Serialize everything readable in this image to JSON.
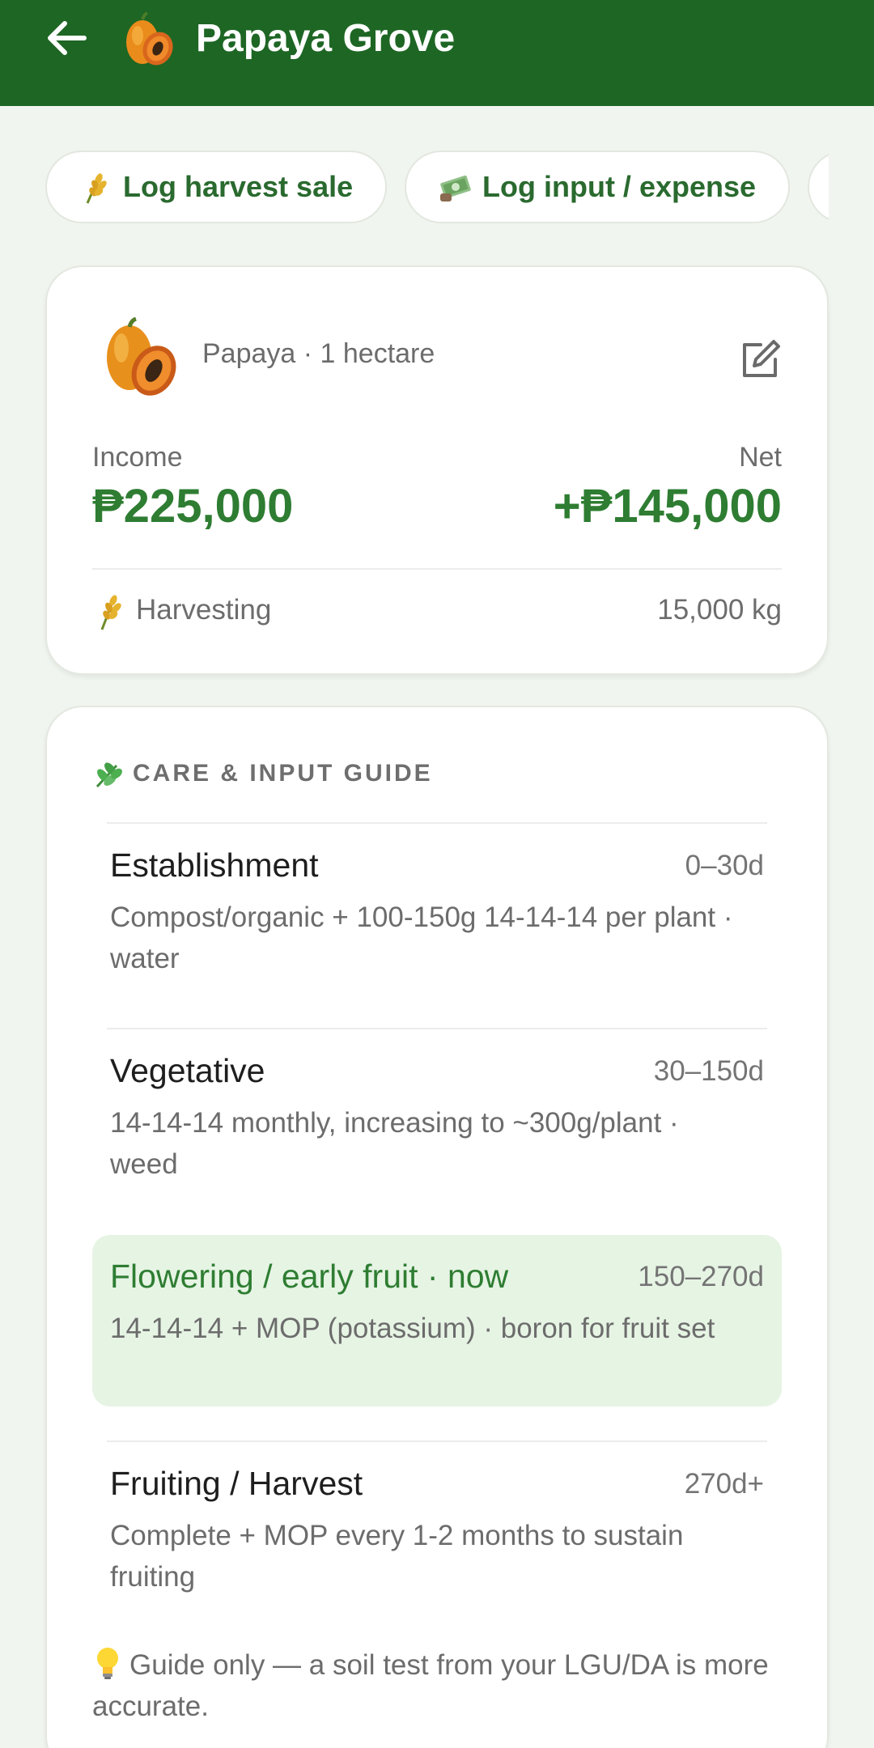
{
  "appbar": {
    "title": "Papaya Grove",
    "back_icon": "arrow-left-icon",
    "crop_icon": "papaya-icon",
    "background": "#1e6624"
  },
  "chips": [
    {
      "label": "Log harvest sale",
      "icon": "wheat-icon"
    },
    {
      "label": "Log input / expense",
      "icon": "money-icon"
    }
  ],
  "summary": {
    "crop_line": "Papaya · 1 hectare",
    "income_label": "Income",
    "income_value": "₱225,000",
    "net_label": "Net",
    "net_value": "+₱145,000",
    "stage": "Harvesting",
    "yield": "15,000 kg",
    "accent": "#2e7d32"
  },
  "guide": {
    "title": "CARE & INPUT GUIDE",
    "phases": [
      {
        "name": "Establishment",
        "range": "0–30d",
        "desc": "Compost/organic + 100-150g 14-14-14 per plant · water",
        "current": false
      },
      {
        "name": "Vegetative",
        "range": "30–150d",
        "desc": "14-14-14 monthly, increasing to ~300g/plant · weed",
        "current": false
      },
      {
        "name": "Flowering / early fruit · now",
        "range": "150–270d",
        "desc": "14-14-14 + MOP (potassium) · boron for fruit set",
        "current": true
      },
      {
        "name": "Fruiting / Harvest",
        "range": "270d+",
        "desc": "Complete + MOP every 1-2 months to sustain fruiting",
        "current": false
      }
    ],
    "note": "Guide only — a soil test from your LGU/DA is more accurate.",
    "current_bg": "#e6f4e4"
  }
}
